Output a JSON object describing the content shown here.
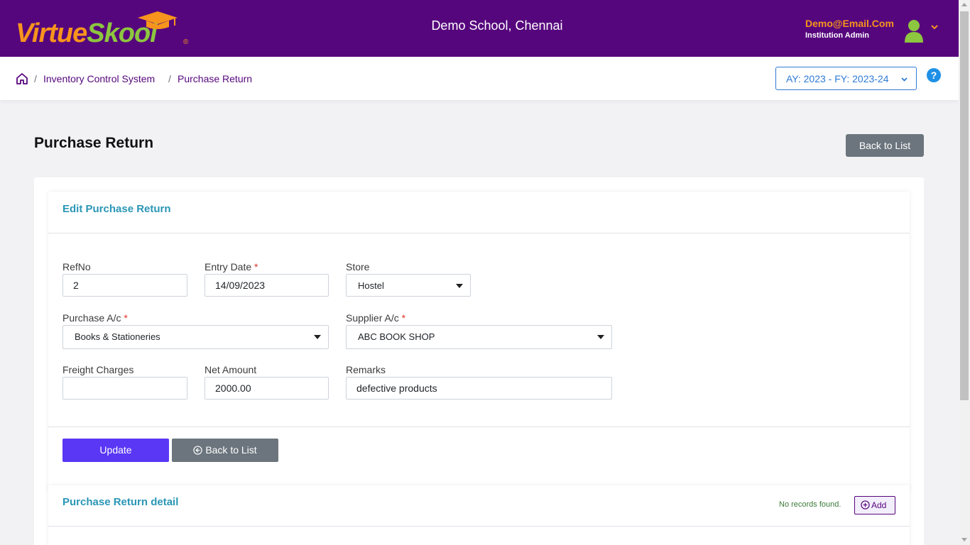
{
  "header": {
    "logo_text_1": "Virtue",
    "logo_text_2": "Skool",
    "logo_reg": "®",
    "school": "Demo School, Chennai",
    "user_email": "Demo@Email.Com",
    "user_role": "Institution Admin",
    "brand_color": "#56067d"
  },
  "breadcrumb": {
    "items": [
      "Inventory Control System",
      "Purchase Return"
    ],
    "sep": "/",
    "academic_year": "AY: 2023 - FY: 2023-24",
    "help": "?"
  },
  "page": {
    "title": "Purchase Return",
    "back_label": "Back to List"
  },
  "form": {
    "title": "Edit Purchase Return",
    "refno_label": "RefNo",
    "refno_value": "2",
    "entry_date_label": "Entry Date",
    "entry_date_value": "14/09/2023",
    "store_label": "Store",
    "store_value": "Hostel",
    "purchase_ac_label": "Purchase A/c",
    "purchase_ac_value": "Books & Stationeries",
    "supplier_ac_label": "Supplier A/c",
    "supplier_ac_value": "ABC BOOK SHOP",
    "freight_label": "Freight Charges",
    "freight_value": "",
    "net_amount_label": "Net Amount",
    "net_amount_value": "2000.00",
    "remarks_label": "Remarks",
    "remarks_value": "defective products",
    "required_mark": "*",
    "update_label": "Update",
    "back_label": "Back to List"
  },
  "detail": {
    "title": "Purchase Return detail",
    "empty_text": "No records found.",
    "add_label": "Add"
  }
}
